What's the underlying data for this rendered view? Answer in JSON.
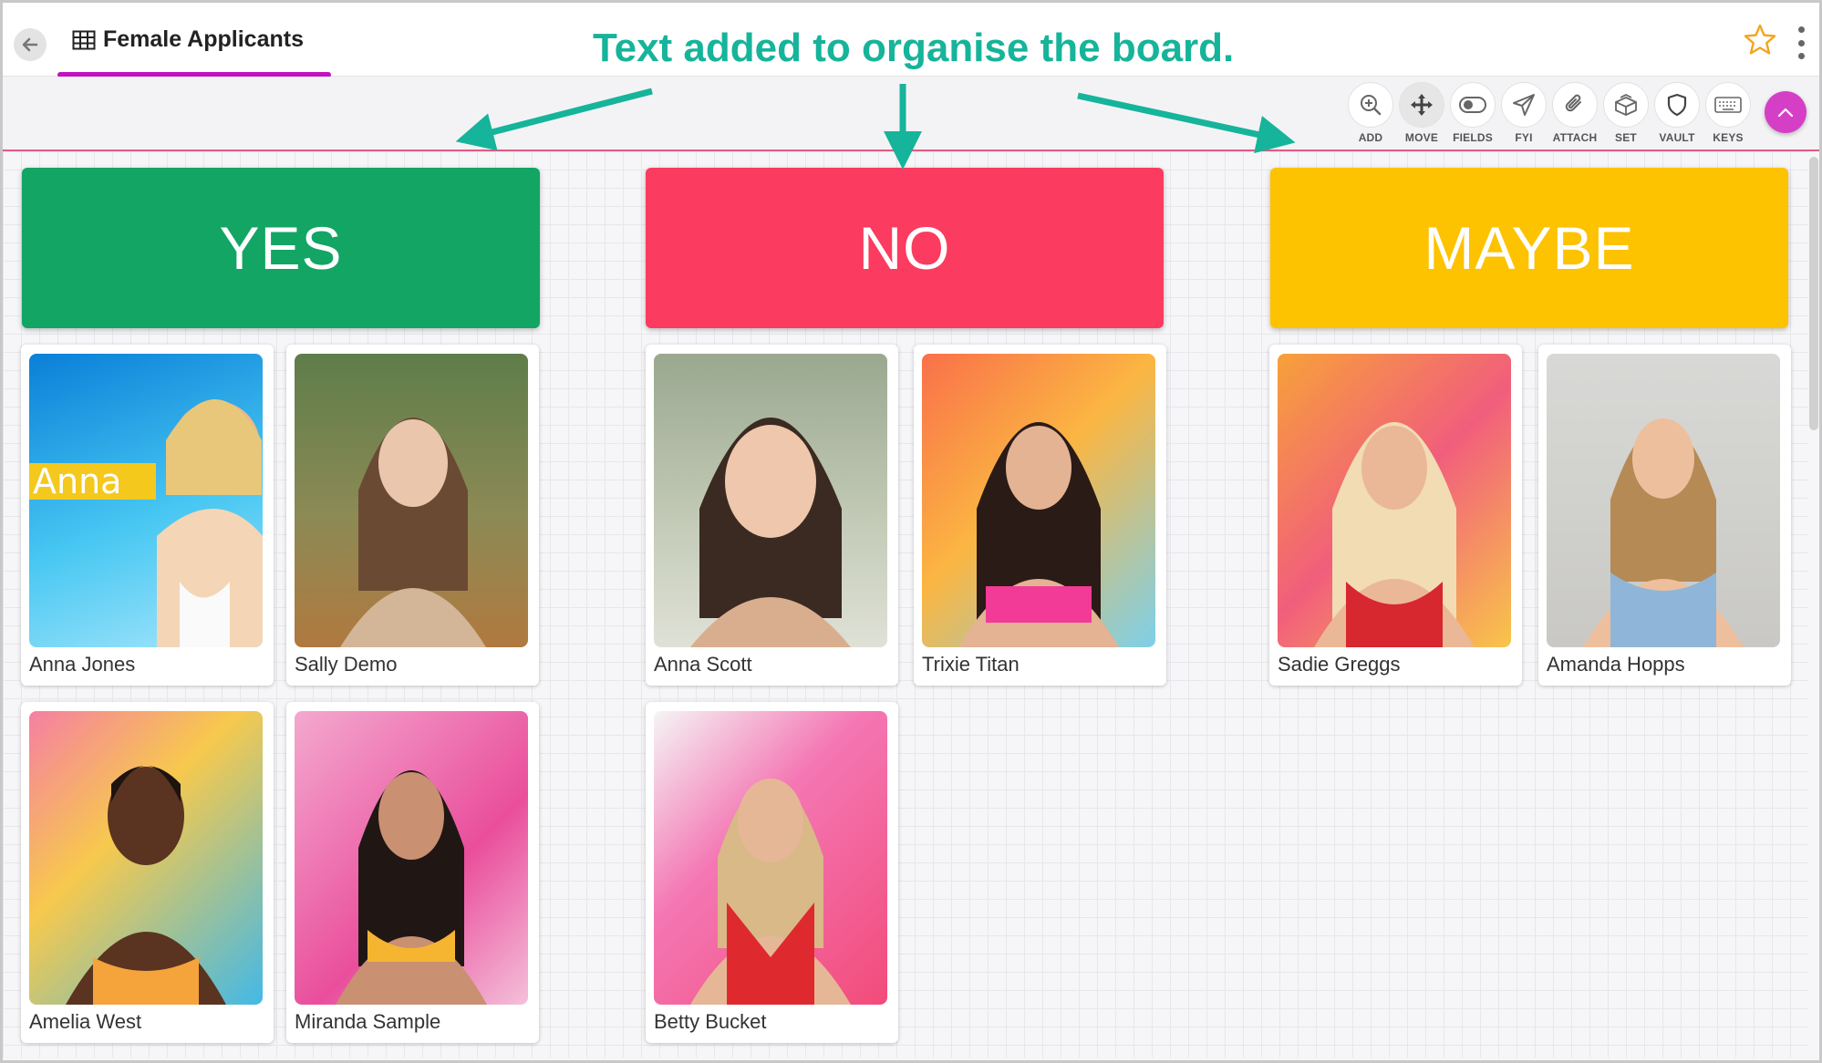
{
  "tab": {
    "title": "Female Applicants"
  },
  "annotation": {
    "text": "Text added to organise the board."
  },
  "toolbar": {
    "tools": [
      {
        "label": "ADD",
        "icon": "zoom-add-icon"
      },
      {
        "label": "MOVE",
        "icon": "move-icon"
      },
      {
        "label": "FIELDS",
        "icon": "toggle-icon"
      },
      {
        "label": "FYI",
        "icon": "paper-plane-icon"
      },
      {
        "label": "ATTACH",
        "icon": "paperclip-icon"
      },
      {
        "label": "SET",
        "icon": "boxes-icon"
      },
      {
        "label": "VAULT",
        "icon": "shield-icon"
      },
      {
        "label": "KEYS",
        "icon": "keyboard-icon"
      }
    ]
  },
  "columns": [
    {
      "title": "YES",
      "color": "#12a564",
      "cards": [
        "Anna Jones",
        "Sally Demo",
        "Amelia West",
        "Miranda Sample"
      ]
    },
    {
      "title": "NO",
      "color": "#fb3b5f",
      "cards": [
        "Anna Scott",
        "Trixie Titan",
        "Betty Bucket"
      ]
    },
    {
      "title": "MAYBE",
      "color": "#fdc200",
      "cards": [
        "Sadie Greggs",
        "Amanda Hopps"
      ]
    }
  ],
  "photo_caption": "Anna",
  "colors": {
    "annotation": "#16b49a",
    "tab_underline": "#c012c0",
    "up_button": "#d53fc5",
    "star": "#f3a51c"
  }
}
